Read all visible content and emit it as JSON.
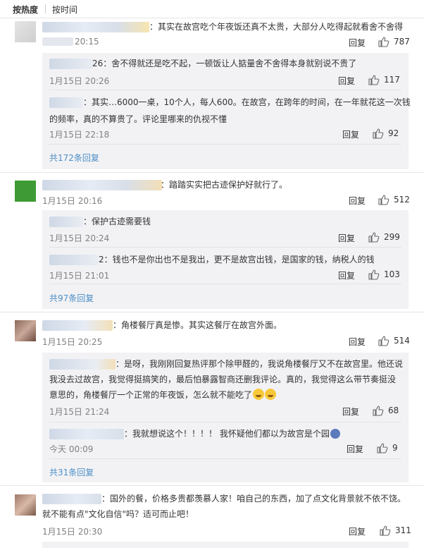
{
  "sort": {
    "hot": "按热度",
    "time": "按时间"
  },
  "labels": {
    "reply": "回复"
  },
  "comments": [
    {
      "text": "：其实在故宫吃个年夜饭还真不太贵，大部分人吃得起就看舍不舍得",
      "time": "20:15",
      "likes": "787",
      "replies": [
        {
          "text": "26：舍不得就还是吃不起，一顿饭让人掂量舍不舍得本身就别说不贵了",
          "time": "1月15日 20:26",
          "likes": "117"
        },
        {
          "text_line1": "：其实…6000一桌，10个人，每人600。在故宫，在跨年的时间，在一年就花这一次钱",
          "text_line2": "的频率，真的不算贵了。评论里哪来的仇视不懂",
          "time": "1月15日 22:18",
          "likes": "92"
        }
      ],
      "more": "共172条回复"
    },
    {
      "text": "：踏踏实实把古迹保护好就行了。",
      "time": "1月15日 20:16",
      "likes": "512",
      "replies": [
        {
          "text": "：保护古迹需要钱",
          "time": "1月15日 20:24",
          "likes": "299"
        },
        {
          "text": "2：钱也不是你出也不是我出，更不是故宫出钱，是国家的钱，纳税人的钱",
          "time": "1月15日 21:01",
          "likes": "103"
        }
      ],
      "more": "共97条回复"
    },
    {
      "text": "：角楼餐厅真是惨。其实这餐厅在故宫外面。",
      "time": "1月15日 20:25",
      "likes": "514",
      "replies": [
        {
          "text_line1": "：是呀，我刚刚回复热评那个除甲醛的，我说角楼餐厅又不在故宫里。他还说",
          "text_line2": "我没去过故宫，我觉得挺搞笑的，最后怕暴露智商还删我评论。真的，我觉得这么带节奏挺没",
          "text_line3": "意思的，角楼餐厅一个正常的年夜饭，怎么就不能吃了",
          "time": "1月15日 21:24",
          "likes": "68"
        },
        {
          "text": "：我就想说这个！！！！ 我怀疑他们都以为故宫是个园",
          "time": "今天 00:09",
          "likes": "9"
        }
      ],
      "more": "共31条回复"
    },
    {
      "text_line1": "：国外的餐，价格多贵都羡慕人家！咱自己的东西，加了点文化背景就不依不饶。",
      "text_line2": "就不能有点\"文化自信\"吗？适可而止吧！",
      "time": "1月15日 20:30",
      "likes": "311"
    }
  ],
  "icons": {
    "like": "thumbs-up-icon",
    "emoji_cry": "laugh-cry-emoji",
    "emoji_globe": "globe-emoji"
  },
  "colors": {
    "link": "#4e8fc5",
    "muted": "#808080",
    "reply_bg": "#f2f2f5"
  }
}
